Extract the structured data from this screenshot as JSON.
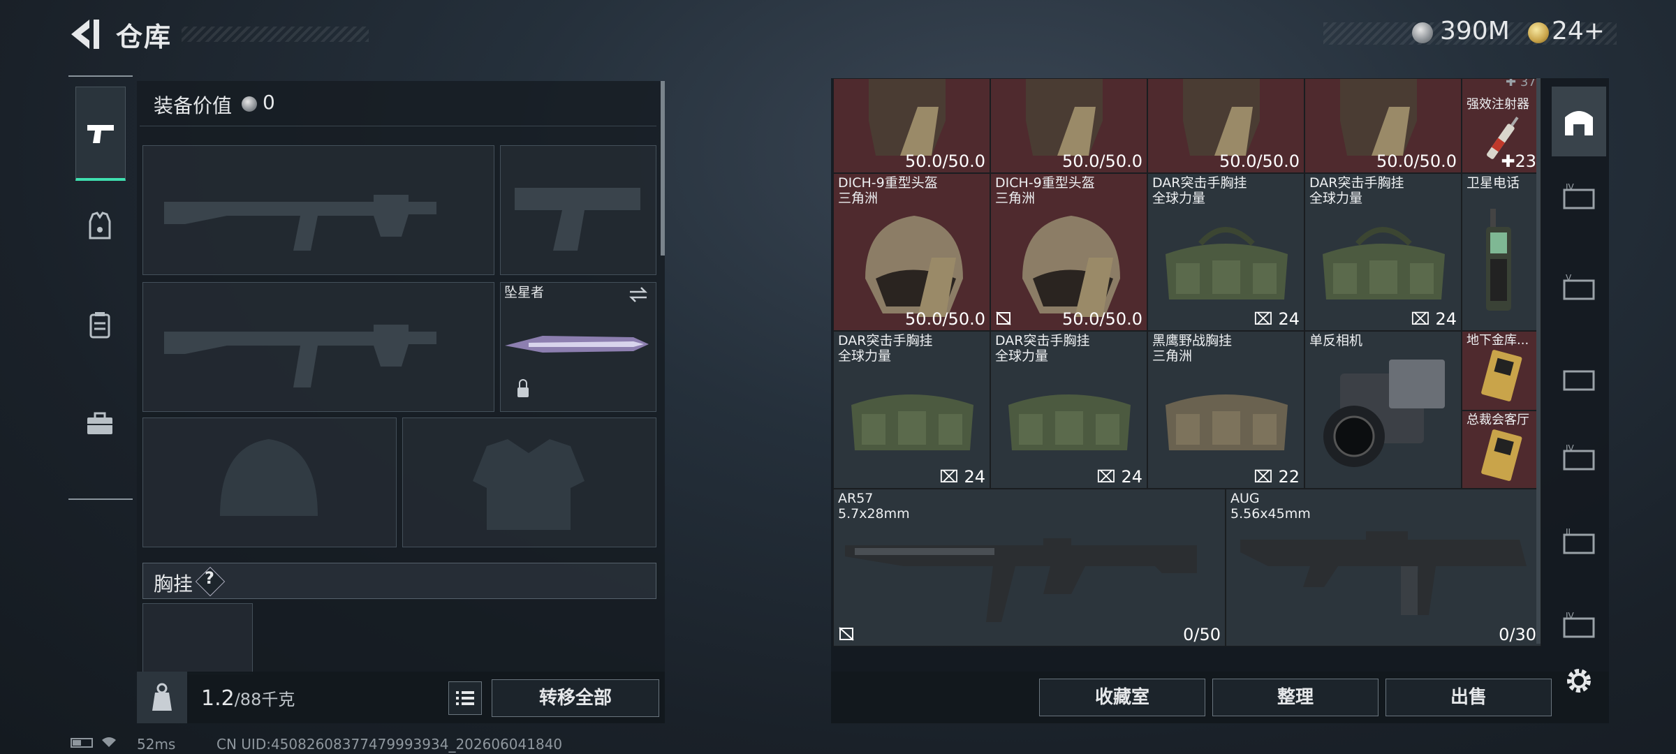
{
  "header": {
    "title": "仓库",
    "back_icon": "back-arrow-icon"
  },
  "currency": {
    "silver": "390M",
    "gold": "24+"
  },
  "loadout": {
    "equip_value_label": "装备价值",
    "equip_value": "0",
    "melee_name": "坠星者",
    "chest_label": "胸挂",
    "chest_help": "?",
    "weight": "1.2",
    "weight_max": "/88千克",
    "transfer_all": "转移全部"
  },
  "stash": {
    "row1": [
      {
        "value": "50.0/50.0"
      },
      {
        "value": "50.0/50.0"
      },
      {
        "value": "50.0/50.0"
      },
      {
        "value": "50.0/50.0"
      },
      {
        "name": "强效注射器",
        "count": "23",
        "overflow": "37"
      }
    ],
    "row2": [
      {
        "name": "DICH-9重型头盔",
        "sub": "三角洲",
        "value": "50.0/50.0"
      },
      {
        "name": "DICH-9重型头盔",
        "sub": "三角洲",
        "value": "50.0/50.0"
      },
      {
        "name": "DAR突击手胸挂",
        "sub": "全球力量",
        "value": "24"
      },
      {
        "name": "DAR突击手胸挂",
        "sub": "全球力量",
        "value": "24"
      },
      {
        "name": "卫星电话"
      }
    ],
    "row3": [
      {
        "name": "DAR突击手胸挂",
        "sub": "全球力量",
        "value": "24"
      },
      {
        "name": "DAR突击手胸挂",
        "sub": "全球力量",
        "value": "24"
      },
      {
        "name": "黑鹰野战胸挂",
        "sub": "三角洲",
        "value": "22"
      },
      {
        "name": "单反相机"
      },
      {
        "name": "地下金库..."
      },
      {
        "name": "总裁会客厅"
      }
    ],
    "guns": [
      {
        "name": "AR57",
        "sub": "5.7x28mm",
        "value": "0/50"
      },
      {
        "name": "AUG",
        "sub": "5.56x45mm",
        "value": "0/30"
      }
    ],
    "buttons": {
      "favorites": "收藏室",
      "sort": "整理",
      "sell": "出售"
    }
  },
  "status": {
    "ping": "52ms",
    "uid": "CN UID:45082608377479993934_202606041840"
  },
  "colors": {
    "accent": "#3fe0b0",
    "item_red": "#4f2a2e"
  }
}
